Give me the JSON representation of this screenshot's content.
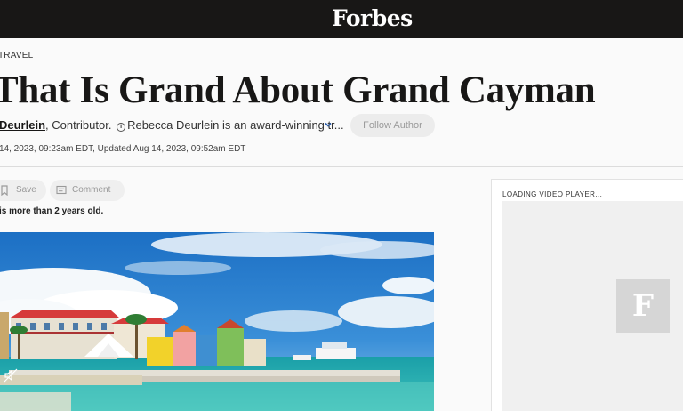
{
  "header": {
    "logo_text": "Forbes",
    "background": "#181716"
  },
  "article": {
    "category": "TRAVEL",
    "headline": "That Is Grand About Grand Cayman",
    "author_name": "Deurlein",
    "author_role": ", Contributor.",
    "author_bio": "Rebecca Deurlein is an award-winning tr...",
    "follow_label": "Follow Author",
    "dateline": "14, 2023, 09:23am EDT, Updated Aug 14, 2023, 09:52am EDT",
    "save_label": "Save",
    "comment_label": "Comment",
    "age_note": "is more than 2 years old."
  },
  "sidebar": {
    "video_label": "LOADING VIDEO PLAYER...",
    "video_logo": "F"
  },
  "icons": {
    "info": "info-icon",
    "chevron": "chevron-down-icon",
    "bookmark": "bookmark-icon",
    "comment": "comment-icon",
    "mute": "mute-icon"
  }
}
